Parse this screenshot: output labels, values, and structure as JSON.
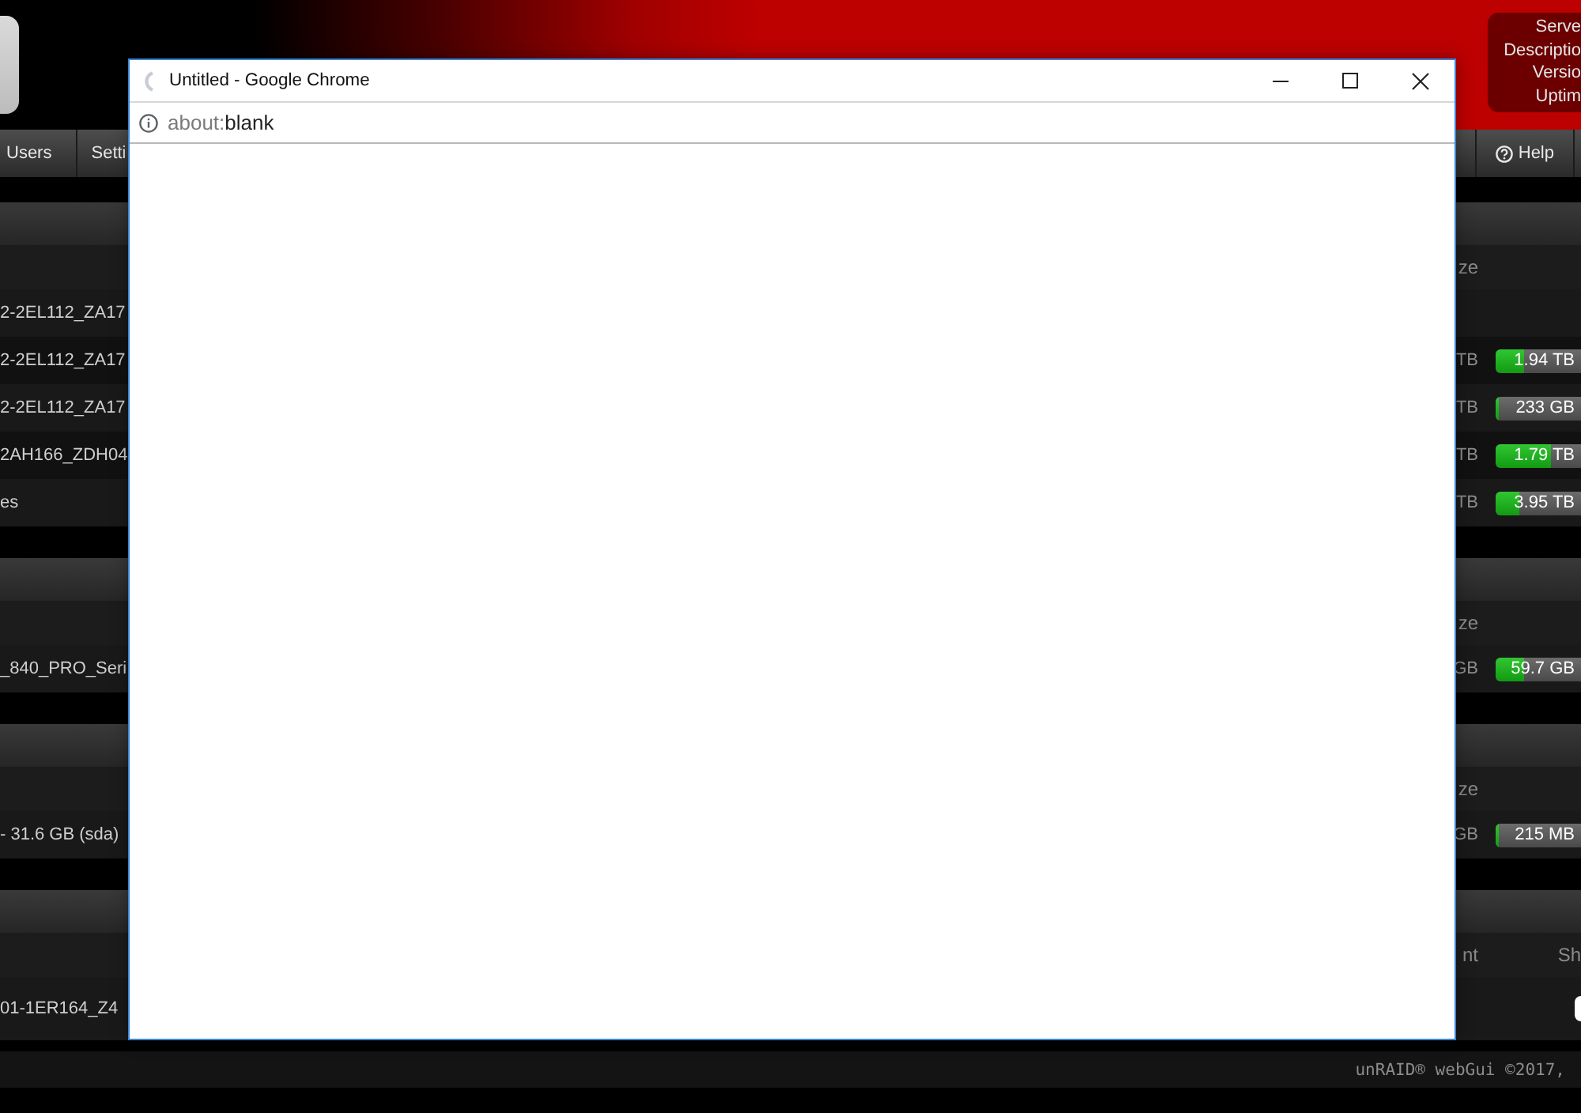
{
  "header": {
    "server_info": [
      "Serve",
      "Descriptio",
      "Versio",
      "Uptim"
    ]
  },
  "nav": {
    "left": [
      {
        "label": "Users"
      },
      {
        "label": "Setti"
      }
    ],
    "right": [
      {
        "label": "Help"
      }
    ]
  },
  "sections": [
    {
      "kind": "usage",
      "columns": [
        "ze"
      ],
      "rows": [
        {
          "device": "2-2EL112_ZA17"
        },
        {
          "device": "2-2EL112_ZA17",
          "size": "TB",
          "used": {
            "reading": "1.94 TB",
            "level": 0.33
          }
        },
        {
          "device": "2-2EL112_ZA17",
          "size": "TB",
          "used": {
            "reading": "233 GB",
            "level": 0.04
          }
        },
        {
          "device": "2AH166_ZDH04",
          "size": "TB",
          "used": {
            "reading": "1.79 TB",
            "level": 0.65
          }
        },
        {
          "device": "es",
          "size": "TB",
          "used": {
            "reading": "3.95 TB",
            "level": 0.28
          }
        }
      ]
    },
    {
      "kind": "usage",
      "columns": [
        "ze"
      ],
      "rows": [
        {
          "device": "_840_PRO_Seri",
          "size": "GB",
          "used": {
            "reading": "59.7 GB",
            "level": 0.33
          }
        }
      ]
    },
    {
      "kind": "usage",
      "columns": [
        "ze"
      ],
      "rows": [
        {
          "device": "- 31.6 GB (sda)",
          "size": "GB",
          "used": {
            "reading": "215 MB",
            "level": 0.03
          }
        }
      ]
    },
    {
      "kind": "devices",
      "columns": [
        "nt",
        "Sh"
      ],
      "rows": [
        {
          "device": "01-1ER164_Z4"
        }
      ]
    }
  ],
  "footer": {
    "text": "unRAID® webGui ©2017,"
  },
  "browser_window": {
    "title": "Untitled - Google Chrome",
    "url_scheme": "about:",
    "url_path": "blank"
  }
}
